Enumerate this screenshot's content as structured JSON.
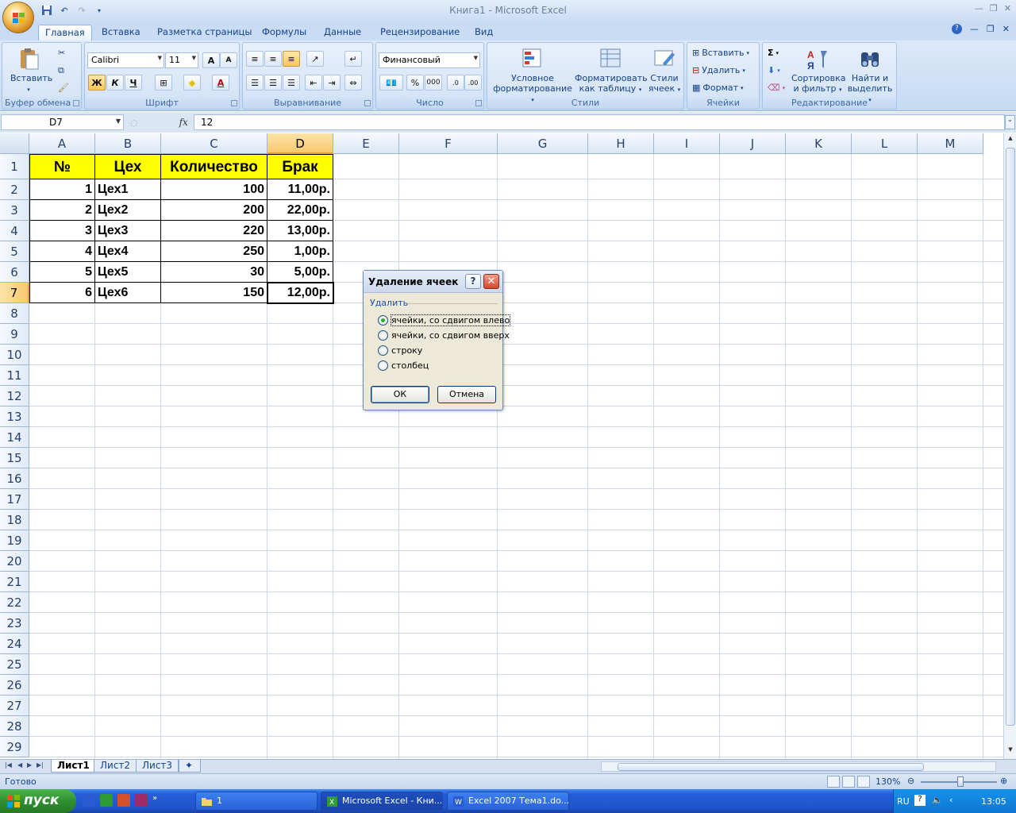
{
  "app": {
    "title": "Книга1 - Microsoft Excel",
    "quick_access": [
      "save-icon",
      "undo-icon",
      "redo-icon",
      "customize-icon"
    ]
  },
  "ribbon_tabs": [
    "Главная",
    "Вставка",
    "Разметка страницы",
    "Формулы",
    "Данные",
    "Рецензирование",
    "Вид"
  ],
  "ribbon": {
    "clipboard": {
      "label": "Буфер обмена",
      "paste": "Вставить"
    },
    "font": {
      "label": "Шрифт",
      "name": "Calibri",
      "size": "11",
      "bold": "Ж",
      "italic": "К",
      "underline": "Ч",
      "grow": "A",
      "shrink": "A",
      "fontcolor": "A"
    },
    "alignment": {
      "label": "Выравнивание"
    },
    "number": {
      "label": "Число",
      "format": "Финансовый",
      "percent": "%",
      "thousands": "000"
    },
    "styles": {
      "label": "Стили",
      "cond1": "Условное",
      "cond2": "форматирование",
      "fmt1": "Форматировать",
      "fmt2": "как таблицу",
      "cs1": "Стили",
      "cs2": "ячеек"
    },
    "cells": {
      "label": "Ячейки",
      "insert": "Вставить",
      "delete": "Удалить",
      "format": "Формат"
    },
    "editing": {
      "label": "Редактирование",
      "sort1": "Сортировка",
      "sort2": "и фильтр",
      "find1": "Найти и",
      "find2": "выделить",
      "sum": "Σ"
    }
  },
  "formula_bar": {
    "name_box": "D7",
    "fx": "fx",
    "content": "12"
  },
  "sheet": {
    "columns": [
      "A",
      "B",
      "C",
      "D",
      "E",
      "F",
      "G",
      "H",
      "I",
      "J",
      "K",
      "L",
      "M"
    ],
    "rows": [
      "1",
      "2",
      "3",
      "4",
      "5",
      "6",
      "7",
      "8",
      "9",
      "10",
      "11",
      "12",
      "13",
      "14",
      "15",
      "16",
      "17",
      "18",
      "19",
      "20",
      "21",
      "22",
      "23",
      "24",
      "25",
      "26",
      "27",
      "28",
      "29"
    ],
    "header": [
      "№",
      "Цех",
      "Количество",
      "Брак"
    ],
    "data": [
      [
        "1",
        "Цех1",
        "100",
        "11,00р."
      ],
      [
        "2",
        "Цех2",
        "200",
        "22,00р."
      ],
      [
        "3",
        "Цех3",
        "220",
        "13,00р."
      ],
      [
        "4",
        "Цех4",
        "250",
        "1,00р."
      ],
      [
        "5",
        "Цех5",
        "30",
        "5,00р."
      ],
      [
        "6",
        "Цех6",
        "150",
        "12,00р."
      ]
    ],
    "selected_cell": "D7",
    "header_fill": "#ffff00"
  },
  "sheet_tabs": [
    "Лист1",
    "Лист2",
    "Лист3"
  ],
  "status": {
    "text": "Готово",
    "zoom": "130%"
  },
  "dialog": {
    "title": "Удаление ячеек",
    "help": "?",
    "close": "✕",
    "group": "Удалить",
    "options": [
      "ячейки, со сдвигом влево",
      "ячейки, со сдвигом вверх",
      "строку",
      "столбец"
    ],
    "selected": 0,
    "ok": "ОК",
    "cancel": "Отмена"
  },
  "taskbar": {
    "start": "пуск",
    "buttons": [
      "1",
      "Microsoft Excel - Кни...",
      "Excel 2007 Тема1.do..."
    ],
    "lang": "RU",
    "time": "13:05"
  }
}
